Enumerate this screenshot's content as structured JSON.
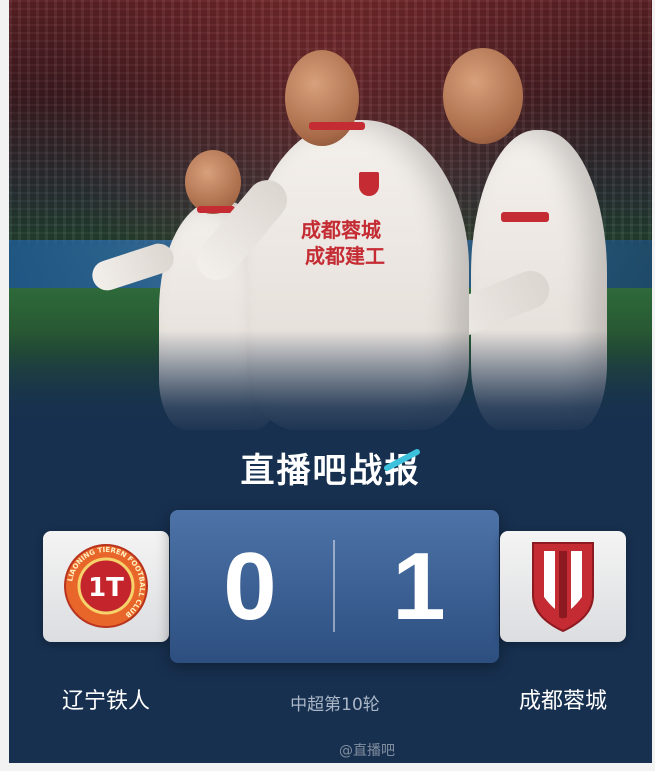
{
  "brand": {
    "title": "直播吧战报"
  },
  "match": {
    "home_team": "辽宁铁人",
    "away_team": "成都蓉城",
    "home_score": "0",
    "away_score": "1",
    "round": "中超第10轮"
  },
  "home_logo": {
    "icon": "liaoning-tieren-crest-icon",
    "ring_text": "LIAONING TIEREN FOOTBALL CLUB",
    "center_text": "1T"
  },
  "away_logo": {
    "icon": "chengdu-rongcheng-crest-icon"
  },
  "photo": {
    "sponsor_line1": "成都蓉城",
    "sponsor_line2": "成都建工"
  },
  "watermark": "@直播吧",
  "colors": {
    "card_background": "#17304f",
    "score_panel": "#3b5f92",
    "club_red": "#c42b33",
    "crest_orange": "#e8662a",
    "accent_cyan": "#3cc2dc"
  }
}
